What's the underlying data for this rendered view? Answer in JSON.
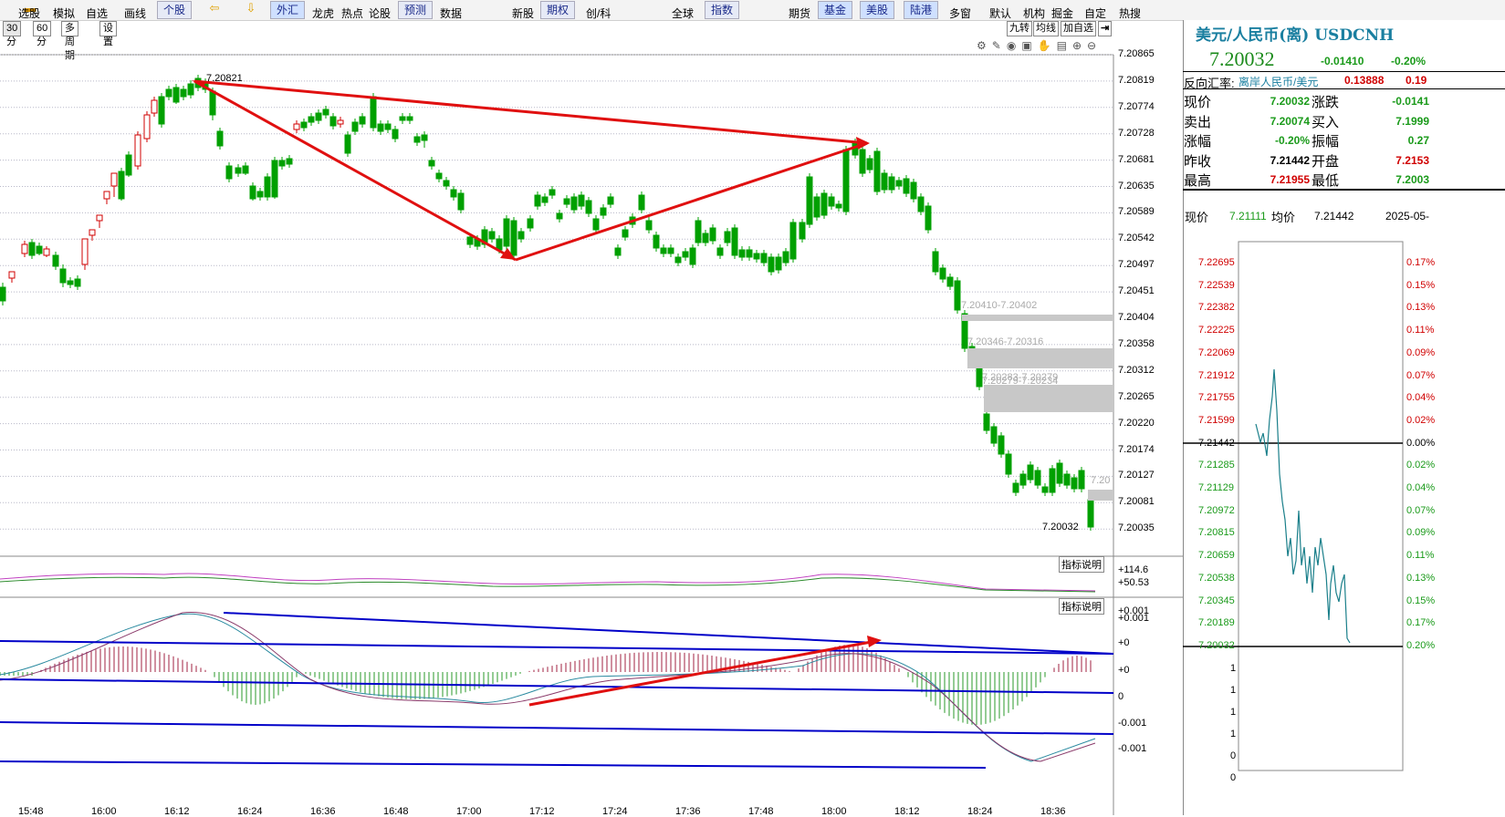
{
  "toolbar": {
    "items": [
      "选股",
      "模拟",
      "自选",
      "画线",
      "个股",
      "外汇",
      "龙虎",
      "热点",
      "论股",
      "预测",
      "数据",
      "新股",
      "期权",
      "创/科",
      "全球",
      "指数",
      "期货",
      "基金",
      "美股",
      "陆港",
      "多窗",
      "默认",
      "机构",
      "掘金",
      "自定",
      "热搜"
    ]
  },
  "tabs": [
    "30分",
    "60分",
    "多周期",
    "设置"
  ],
  "right_tools": [
    "九转",
    "均线",
    "加自选"
  ],
  "chart": {
    "price_ticks": [
      "7.20865",
      "7.20819",
      "7.20774",
      "7.20728",
      "7.20681",
      "7.20635",
      "7.20589",
      "7.20542",
      "7.20497",
      "7.20451",
      "7.20404",
      "7.20358",
      "7.20312",
      "7.20265",
      "7.20220",
      "7.20174",
      "7.20127",
      "7.20081",
      "7.20035"
    ],
    "high_label": "7.20821",
    "last_label": "7.20032",
    "gap_labels": [
      "7.20410-7.20402",
      "7.20346-7.20316",
      "7.20283-7.20279",
      "7.20279-7.20234",
      "7.20"
    ],
    "time_ticks": [
      "15:48",
      "16:00",
      "16:12",
      "16:24",
      "16:36",
      "16:48",
      "17:00",
      "17:12",
      "17:24",
      "17:36",
      "17:48",
      "18:00",
      "18:12",
      "18:24",
      "18:36"
    ],
    "ind1_label": "指标说明",
    "ind1_ticks": [
      "+114.6",
      "+50.53"
    ],
    "ind2_label": "指标说明",
    "ind2_ticks": [
      "+0.001",
      "+0.001",
      "+0",
      "+0",
      "0",
      "-0.001",
      "-0.001"
    ],
    "colors": {
      "up": "#d00000",
      "down": "#00a000",
      "line": "#0000c8",
      "arrow": "#e01010"
    }
  },
  "quote": {
    "title": "美元/人民币(离) USDCNH",
    "price": "7.20032",
    "change": "-0.01410",
    "change_pct": "-0.20%",
    "reverse_label": "反向汇率:",
    "reverse_name": "离岸人民币/美元",
    "reverse_value": "0.13888",
    "reverse_pct": "0.19",
    "rows": [
      {
        "k1": "现价",
        "v1": "7.20032",
        "k2": "涨跌",
        "v2": "-0.0141"
      },
      {
        "k1": "卖出",
        "v1": "7.20074",
        "k2": "买入",
        "v2": "7.1999"
      },
      {
        "k1": "涨幅",
        "v1": "-0.20%",
        "k2": "振幅",
        "v2": "0.27"
      },
      {
        "k1": "昨收",
        "v1": "7.21442",
        "k2": "开盘",
        "v2": "7.2153"
      },
      {
        "k1": "最高",
        "v1": "7.21955",
        "k2": "最低",
        "v2": "7.2003"
      }
    ],
    "mini_header": {
      "now_label": "现价",
      "now_value": "7.21111",
      "avg_label": "均价",
      "avg_value": "7.21442",
      "date": "2025-05-"
    },
    "mini_left": [
      "7.22695",
      "7.22539",
      "7.22382",
      "7.22225",
      "7.22069",
      "7.21912",
      "7.21755",
      "7.21599",
      "7.21442",
      "7.21285",
      "7.21129",
      "7.20972",
      "7.20815",
      "7.20659",
      "7.20538",
      "7.20345",
      "7.20189",
      "7.20032"
    ],
    "mini_right": [
      "0.17%",
      "0.15%",
      "0.13%",
      "0.11%",
      "0.09%",
      "0.07%",
      "0.04%",
      "0.02%",
      "0.00%",
      "0.02%",
      "0.04%",
      "0.07%",
      "0.09%",
      "0.11%",
      "0.13%",
      "0.15%",
      "0.17%",
      "0.20%"
    ],
    "vol_ticks": [
      "1",
      "1",
      "1",
      "1",
      "0",
      "0"
    ]
  }
}
